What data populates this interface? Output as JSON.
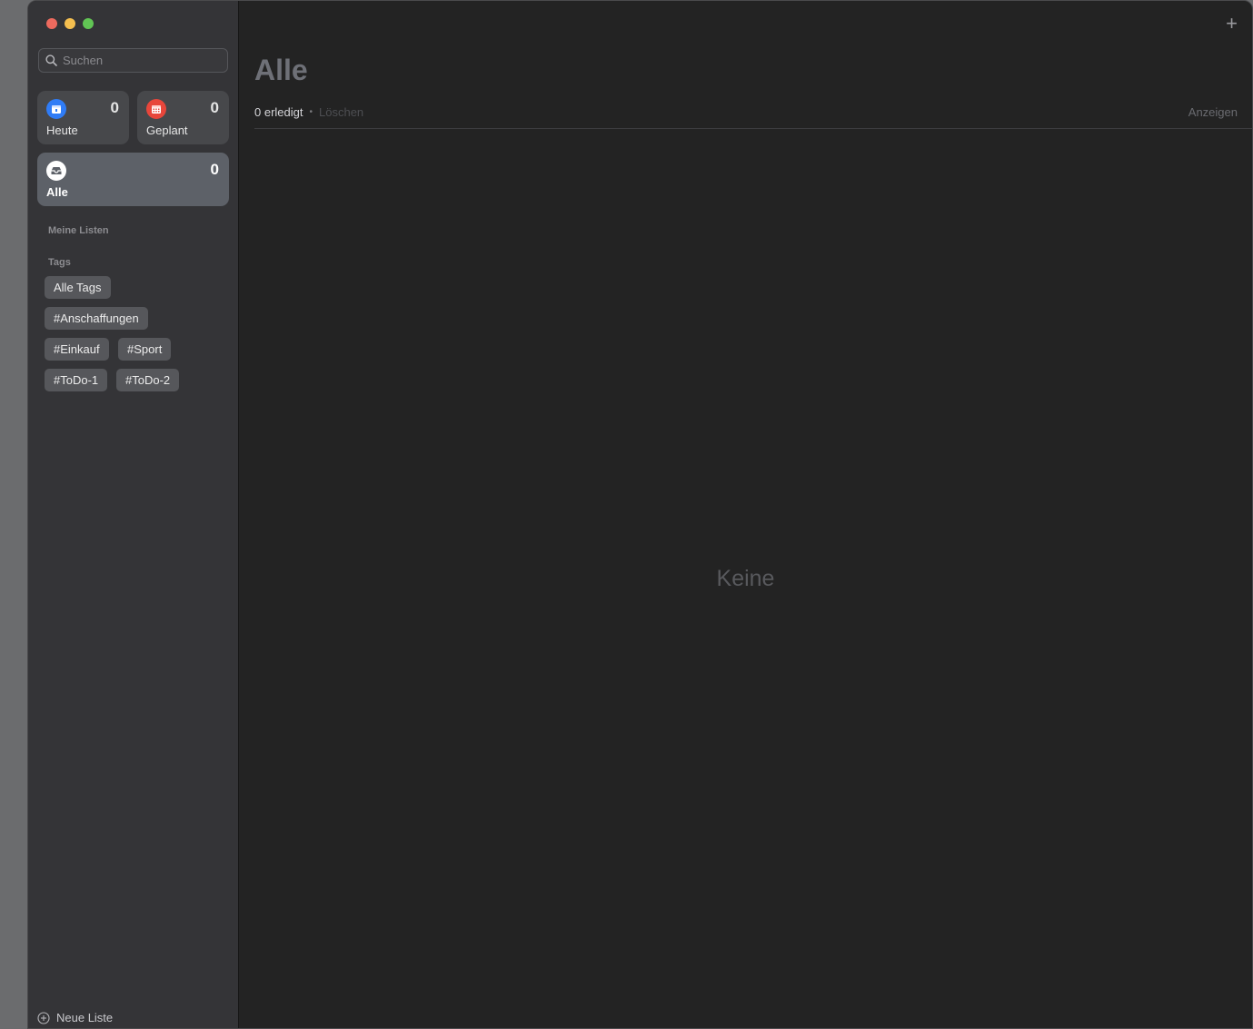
{
  "search": {
    "placeholder": "Suchen"
  },
  "smart_lists": [
    {
      "label": "Heute",
      "count": "0",
      "color": "#2f7cf6",
      "icon": "calendar-today-icon"
    },
    {
      "label": "Geplant",
      "count": "0",
      "color": "#e8463b",
      "icon": "calendar-grid-icon"
    },
    {
      "label": "Alle",
      "count": "0",
      "color": "#ffffff",
      "icon": "tray-icon",
      "selected": true
    }
  ],
  "sidebar": {
    "my_lists_label": "Meine Listen",
    "tags_label": "Tags",
    "tags": [
      "Alle Tags",
      "#Anschaffungen",
      "#Einkauf",
      "#Sport",
      "#ToDo-1",
      "#ToDo-2"
    ],
    "new_list_label": "Neue Liste"
  },
  "main": {
    "title": "Alle",
    "done_text": "0 erledigt",
    "bullet": "•",
    "delete_label": "Löschen",
    "show_label": "Anzeigen",
    "empty_text": "Keine",
    "add_symbol": "+"
  }
}
